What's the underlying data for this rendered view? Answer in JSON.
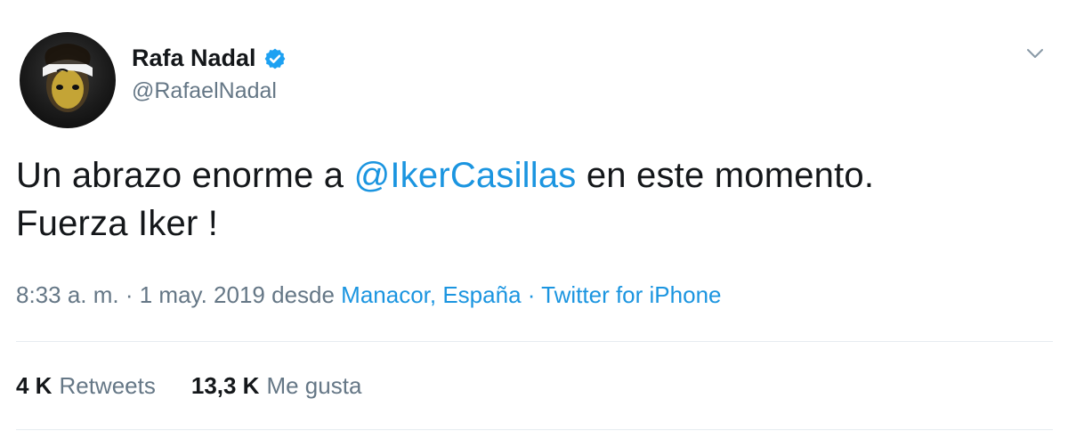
{
  "user": {
    "display_name": "Rafa Nadal",
    "handle": "@RafaelNadal",
    "verified_icon": "verified-badge-icon",
    "avatar_icon": "profile-photo"
  },
  "menu": {
    "icon": "chevron-down-icon"
  },
  "tweet": {
    "line1_before": "Un abrazo enorme a ",
    "mention": "@IkerCasillas",
    "line1_after": " en este momento.",
    "line2": "Fuerza Iker !"
  },
  "meta": {
    "time_date": "8:33 a. m. · 1 may. 2019 desde ",
    "location": "Manacor, España",
    "separator": " · ",
    "source": "Twitter for iPhone"
  },
  "stats": {
    "retweets_count": "4 K",
    "retweets_label": "Retweets",
    "likes_count": "13,3 K",
    "likes_label": "Me gusta"
  },
  "colors": {
    "link": "#1b95e0",
    "text": "#14171a",
    "secondary": "#657786",
    "divider": "#e6ecf0"
  }
}
